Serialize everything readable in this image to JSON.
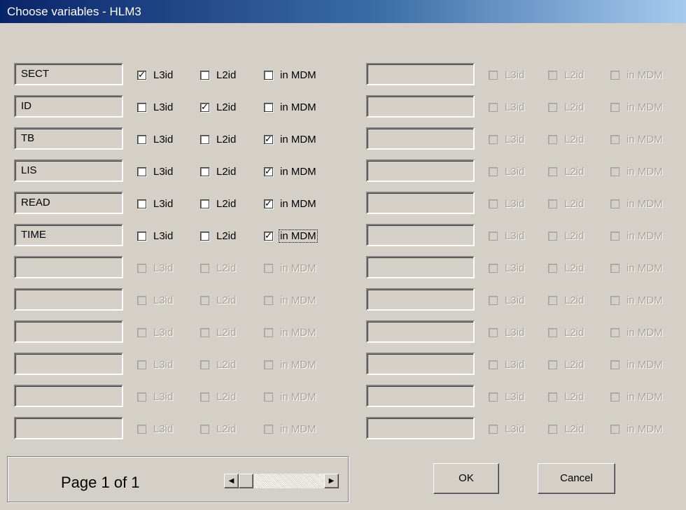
{
  "window": {
    "title": "Choose variables - HLM3"
  },
  "checkbox_labels": {
    "l3": "L3id",
    "l2": "L2id",
    "mdm": "in MDM"
  },
  "rows": [
    {
      "variable": "SECT",
      "l3": true,
      "l2": false,
      "mdm": false
    },
    {
      "variable": "ID",
      "l3": false,
      "l2": true,
      "mdm": false
    },
    {
      "variable": "TB",
      "l3": false,
      "l2": false,
      "mdm": true
    },
    {
      "variable": "LIS",
      "l3": false,
      "l2": false,
      "mdm": true
    },
    {
      "variable": "READ",
      "l3": false,
      "l2": false,
      "mdm": true
    },
    {
      "variable": "TIME",
      "l3": false,
      "l2": false,
      "mdm": true
    },
    {
      "variable": "",
      "l3": false,
      "l2": false,
      "mdm": false
    },
    {
      "variable": "",
      "l3": false,
      "l2": false,
      "mdm": false
    },
    {
      "variable": "",
      "l3": false,
      "l2": false,
      "mdm": false
    },
    {
      "variable": "",
      "l3": false,
      "l2": false,
      "mdm": false
    },
    {
      "variable": "",
      "l3": false,
      "l2": false,
      "mdm": false
    },
    {
      "variable": "",
      "l3": false,
      "l2": false,
      "mdm": false
    }
  ],
  "pager": {
    "text": "Page 1 of 1",
    "left_arrow": "◀",
    "right_arrow": "▶"
  },
  "buttons": {
    "ok": "OK",
    "cancel": "Cancel"
  }
}
